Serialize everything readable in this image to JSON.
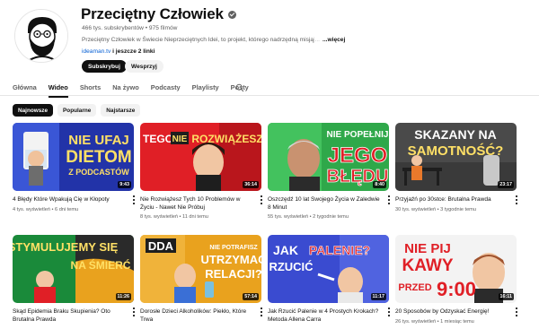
{
  "channel": {
    "name": "Przeciętny Człowiek",
    "meta": "466 tys. subskrybentów • 975 filmów",
    "description": "Przeciętny Człowiek w Świecie Nieprzeciętnych Idei, to projekt, którego nadrzędną misją",
    "description_fade": "j...",
    "more": "...więcej",
    "link": "ideaman.tv",
    "link_extra": "i jeszcze 2 linki",
    "subscribe": "Subskrybuj",
    "join": "Wesprzyj"
  },
  "tabs": [
    "Główna",
    "Wideo",
    "Shorts",
    "Na żywo",
    "Podcasty",
    "Playlisty",
    "Posty"
  ],
  "active_tab": "Wideo",
  "chips": [
    "Najnowsze",
    "Popularne",
    "Najstarsze"
  ],
  "videos": [
    {
      "title": "4 Błędy Które Wpakują Cię w Kłopoty",
      "meta": "4 tys. wyświetleń • 6 dni temu",
      "duration": "9:43",
      "thumb_text": [
        "NIE UFAJ",
        "DIETOM",
        "Z PODCASTÓW"
      ]
    },
    {
      "title": "Nie Rozwiążesz Tych 10 Problemów w Życiu - Nawet Nie Próbuj",
      "meta": "8 tys. wyświetleń • 11 dni temu",
      "duration": "36:14",
      "thumb_text": [
        "TEGO",
        "NIE",
        "ROZWIĄŻESZ"
      ]
    },
    {
      "title": "Oszczędź 10 lat Swojego Życia w Zaledwie 8 Minut",
      "meta": "55 tys. wyświetleń • 2 tygodnie temu",
      "duration": "8:40",
      "thumb_text": [
        "NIE POPEŁNIJ",
        "JEGO",
        "BŁĘDU"
      ]
    },
    {
      "title": "Przyjaźń po 30stce: Brutalna Prawda",
      "meta": "30 tys. wyświetleń • 3 tygodnie temu",
      "duration": "23:17",
      "thumb_text": [
        "SKAZANY NA",
        "SAMOTNOŚĆ?"
      ]
    },
    {
      "title": "Skąd Epidemia Braku Skupienia? Oto Brutalna Prawda",
      "meta": "",
      "duration": "11:26",
      "thumb_text": [
        "STYMULUJEMY SIĘ",
        "NA ŚMIERĆ"
      ]
    },
    {
      "title": "Dorosłe Dzieci Alkoholików: Piekło, Które Trwa",
      "meta": "",
      "duration": "57:14",
      "thumb_text": [
        "DDA",
        "NIE POTRAFISZ",
        "UTRZYMAĆ",
        "RELACJI?"
      ]
    },
    {
      "title": "Jak Rzucić Palenie w 4 Prostych Krokach? Metoda Allena Carra",
      "meta": "",
      "duration": "11:17",
      "thumb_text": [
        "JAK",
        "RZUCIĆ",
        "PALENIE?"
      ]
    },
    {
      "title": "20 Sposobów by Odzyskać Energię!",
      "meta": "26 tys. wyświetleń • 1 miesiąc temu",
      "duration": "16:11",
      "thumb_text": [
        "NIE PIJ",
        "KAWY",
        "PRZED",
        "9:00"
      ]
    }
  ]
}
